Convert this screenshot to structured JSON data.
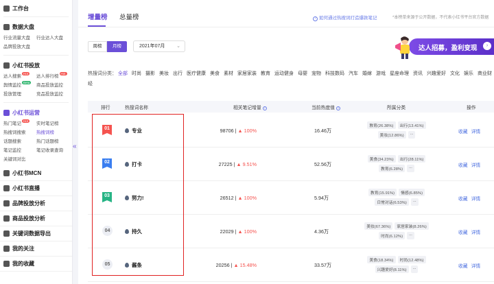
{
  "sidebar": {
    "workbench": "工作台",
    "data_board": {
      "title": "数据大盘",
      "items": [
        "行业流量大盘",
        "行业达人大盘",
        "品牌投放大盘"
      ]
    },
    "rb_ad": {
      "title": "小红书投放",
      "items": [
        "达人搜索",
        "达人排行榜",
        "舆情监控",
        "商品投放监控",
        "投放管理",
        "竞品投放监控"
      ],
      "hot_badge": "Hot",
      "beta_badge": "Beta"
    },
    "rb_ops": {
      "title": "小红书运营",
      "items": [
        "热门笔记",
        "实时笔记榜",
        "热搜词搜索",
        "热搜词榜",
        "话题搜索",
        "热门话题榜",
        "笔记监控",
        "笔记收录查询",
        "关键词对比"
      ]
    },
    "nav": [
      "小红书MCN",
      "小红书直播",
      "品牌投放分析",
      "商品投放分析",
      "关键词数据导出",
      "我的关注",
      "我的收藏"
    ]
  },
  "tabs": {
    "increase": "增量榜",
    "total": "总量榜"
  },
  "help_link": "如何通过热搜词打造爆款笔记",
  "note": "*本榜单来源于公开数据，不代表小红书平台官方数据",
  "period": {
    "week": "周榜",
    "month": "月榜",
    "selected_month": "2021年07月"
  },
  "banner": {
    "text": "达人招募，盈利变现"
  },
  "categories": {
    "label": "热搜词分类：",
    "items": [
      "全部",
      "时尚",
      "摄影",
      "美妆",
      "出行",
      "医疗健康",
      "美食",
      "素材",
      "家居家装",
      "教育",
      "运动健身",
      "母婴",
      "宠物",
      "科技数码",
      "汽车",
      "婚嫁",
      "游戏",
      "星座命理",
      "资讯",
      "兴趣爱好",
      "文化",
      "娱乐",
      "商业财经"
    ]
  },
  "table": {
    "headers": {
      "rank": "排行",
      "word": "热搜词名称",
      "notes": "相关笔记增量",
      "heat": "当前热度值",
      "category": "所属分类",
      "ops": "操作"
    },
    "ops": {
      "fav": "收藏",
      "detail": "详情"
    },
    "rows": [
      {
        "rank": "01",
        "word": "专业",
        "notes": "98706",
        "growth": "100%",
        "heat": "16.46万",
        "chips": [
          "教育(26.38%)",
          "出行(13.41%)",
          "美妆(12.86%)",
          "..."
        ]
      },
      {
        "rank": "02",
        "word": "打卡",
        "notes": "27225",
        "growth": "9.51%",
        "heat": "52.56万",
        "chips": [
          "美食(34.23%)",
          "出行(28.11%)",
          "教育(6.28%)",
          "..."
        ]
      },
      {
        "rank": "03",
        "word": "努力!",
        "notes": "26512",
        "growth": "100%",
        "heat": "5.94万",
        "chips": [
          "教育(15.91%)",
          "情感(6.85%)",
          "日常对话(6.53%)",
          "..."
        ]
      },
      {
        "rank": "04",
        "word": "持久",
        "notes": "22029",
        "growth": "100%",
        "heat": "4.36万",
        "chips": [
          "美妆(67.36%)",
          "家居家装(8.26%)",
          "时尚(6.12%)",
          "..."
        ]
      },
      {
        "rank": "05",
        "word": "酱条",
        "notes": "20256",
        "growth": "15.48%",
        "heat": "33.57万",
        "chips": [
          "美食(18.34%)",
          "时尚(12.48%)",
          "兴趣爱好(8.11%)",
          "..."
        ]
      }
    ]
  },
  "colors": {
    "accent": "#6b4fd8",
    "red": "#f5534f",
    "rank1": "#f5534f",
    "rank2": "#3a7ef0",
    "rank3": "#27b485"
  }
}
